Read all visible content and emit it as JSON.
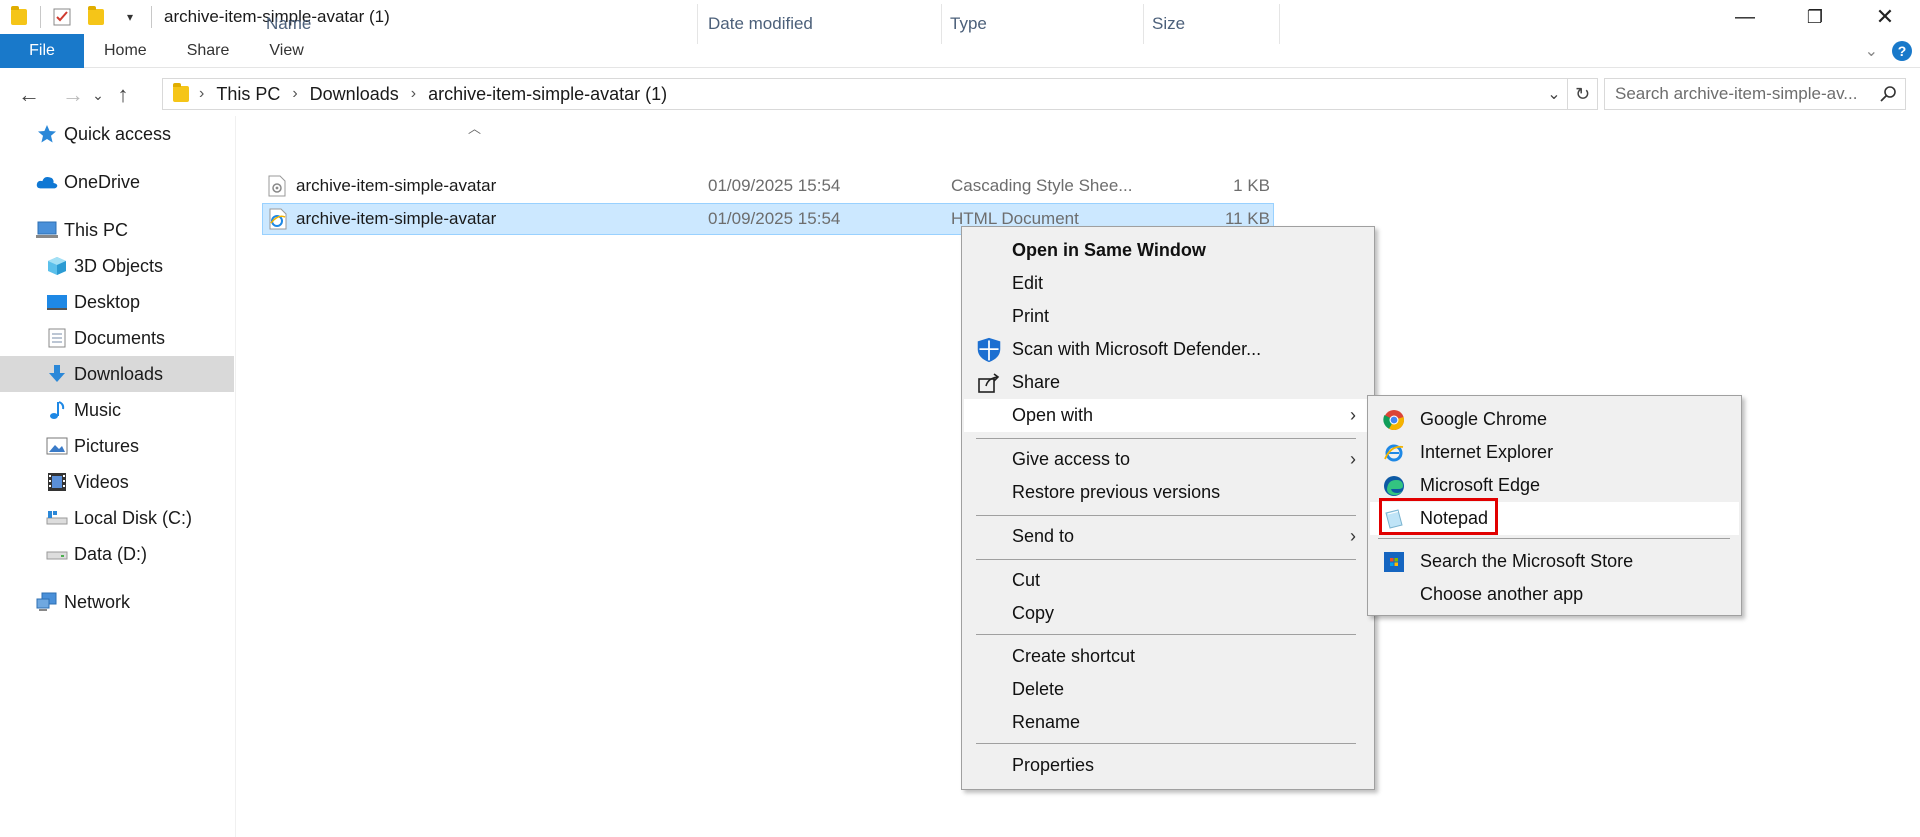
{
  "window": {
    "title": "archive-item-simple-avatar (1)",
    "controls": {
      "minimize": "—",
      "restore": "❐",
      "close": "✕"
    }
  },
  "ribbon": {
    "tabs": [
      "File",
      "Home",
      "Share",
      "View"
    ],
    "help": "?"
  },
  "address": {
    "crumbs": [
      "This PC",
      "Downloads",
      "archive-item-simple-avatar (1)"
    ],
    "search_placeholder": "Search archive-item-simple-av..."
  },
  "nav": {
    "items": [
      {
        "label": "Quick access",
        "icon": "star-icon"
      },
      {
        "label": "OneDrive",
        "icon": "cloud-icon"
      },
      {
        "label": "This PC",
        "icon": "computer-icon"
      },
      {
        "label": "3D Objects",
        "icon": "cube-icon"
      },
      {
        "label": "Desktop",
        "icon": "desktop-icon"
      },
      {
        "label": "Documents",
        "icon": "document-icon"
      },
      {
        "label": "Downloads",
        "icon": "download-icon"
      },
      {
        "label": "Music",
        "icon": "music-icon"
      },
      {
        "label": "Pictures",
        "icon": "pictures-icon"
      },
      {
        "label": "Videos",
        "icon": "video-icon"
      },
      {
        "label": "Local Disk (C:)",
        "icon": "disk-icon"
      },
      {
        "label": "Data (D:)",
        "icon": "drive-icon"
      },
      {
        "label": "Network",
        "icon": "network-icon"
      }
    ],
    "selected": "Downloads"
  },
  "files": {
    "columns": [
      "Name",
      "Date modified",
      "Type",
      "Size"
    ],
    "rows": [
      {
        "name": "archive-item-simple-avatar",
        "date": "01/09/2025 15:54",
        "type": "Cascading Style Shee...",
        "size": "1 KB",
        "icon": "css-file-icon"
      },
      {
        "name": "archive-item-simple-avatar",
        "date": "01/09/2025 15:54",
        "type": "HTML Document",
        "size": "11 KB",
        "icon": "html-file-icon"
      }
    ]
  },
  "context_menu": {
    "items": [
      "Open in Same Window",
      "Edit",
      "Print",
      "Scan with Microsoft Defender...",
      "Share",
      "Open with",
      "Give access to",
      "Restore previous versions",
      "Send to",
      "Cut",
      "Copy",
      "Create shortcut",
      "Delete",
      "Rename",
      "Properties"
    ]
  },
  "open_with_submenu": {
    "items": [
      "Google Chrome",
      "Internet Explorer",
      "Microsoft Edge",
      "Notepad",
      "Search the Microsoft Store",
      "Choose another app"
    ],
    "highlighted": "Notepad"
  },
  "colors": {
    "accent": "#1979ca",
    "selection": "#cce8ff",
    "highlight_box": "#e10000"
  }
}
